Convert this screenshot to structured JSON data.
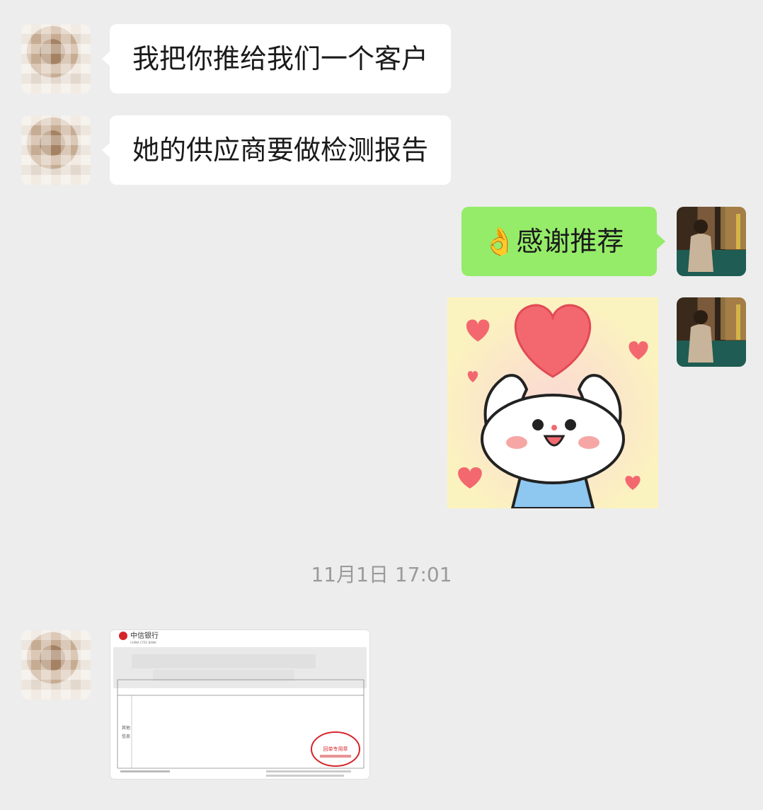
{
  "messages": [
    {
      "side": "left",
      "text": "我把你推给我们一个客户"
    },
    {
      "side": "left",
      "text": "她的供应商要做检测报告"
    },
    {
      "side": "right",
      "emoji": "👌",
      "text": "感谢推荐"
    },
    {
      "side": "right",
      "type": "sticker",
      "sticker_icon": "heart-bunny-sticker"
    }
  ],
  "timestamp": "11月1日 17:01",
  "document_message": {
    "bank_name": "中信银行",
    "bank_name_en": "CHINA CITIC BANK",
    "stamp_text": "回单专用章",
    "field_label_1": "其他",
    "field_label_2": "信息"
  },
  "colors": {
    "background": "#ededed",
    "incoming_bubble": "#ffffff",
    "outgoing_bubble": "#95ec69",
    "timestamp_text": "#9a9a9a",
    "bank_red": "#d6252a"
  }
}
